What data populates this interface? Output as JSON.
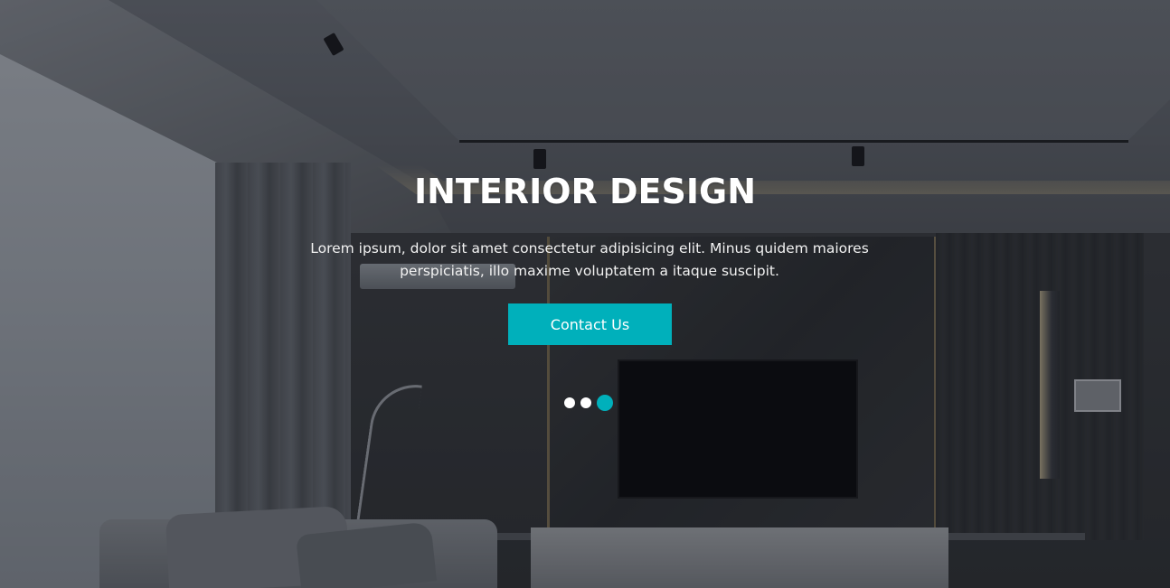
{
  "hero": {
    "title": "INTERIOR DESIGN",
    "description": "Lorem ipsum, dolor sit amet consectetur adipisicing elit. Minus quidem maiores perspiciatis, illo maxime voluptatem a itaque suscipit.",
    "cta_label": "Contact Us",
    "background_image": "dark living room interior with TV wall, grey sofa and curtains"
  },
  "carousel": {
    "slide_count": 3,
    "active_index": 2
  },
  "colors": {
    "accent": "#00b0bb",
    "text": "#ffffff",
    "inactive_dot": "#ffffff"
  }
}
